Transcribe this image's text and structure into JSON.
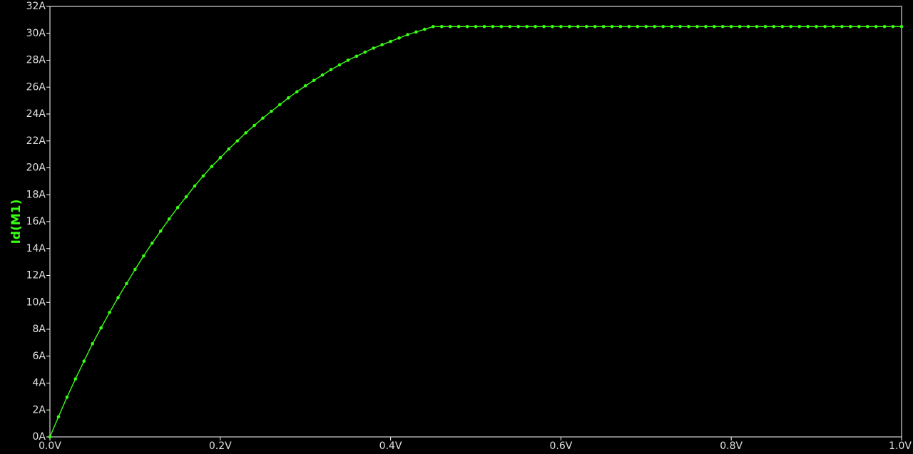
{
  "chart_data": {
    "type": "line",
    "xlabel": "",
    "ylabel": "Id(M1)",
    "xlim": [
      0,
      1.0
    ],
    "ylim": [
      0,
      32
    ],
    "x_ticks": [
      "0.0V",
      "0.2V",
      "0.4V",
      "0.6V",
      "0.8V",
      "1.0V"
    ],
    "x_tick_values": [
      0,
      0.2,
      0.4,
      0.6,
      0.8,
      1.0
    ],
    "y_ticks": [
      "0A",
      "2A",
      "4A",
      "6A",
      "8A",
      "10A",
      "12A",
      "14A",
      "16A",
      "18A",
      "20A",
      "22A",
      "24A",
      "26A",
      "28A",
      "30A",
      "32A"
    ],
    "y_tick_values": [
      0,
      2,
      4,
      6,
      8,
      10,
      12,
      14,
      16,
      18,
      20,
      22,
      24,
      26,
      28,
      30,
      32
    ],
    "grid": false,
    "background": "#000000",
    "axis_color": "#ffffff",
    "series": [
      {
        "color": "#39ff14",
        "markers": true,
        "x": [
          0,
          0.01,
          0.02,
          0.03,
          0.04,
          0.05,
          0.06,
          0.07,
          0.08,
          0.09,
          0.1,
          0.11,
          0.12,
          0.13,
          0.14,
          0.15,
          0.16,
          0.17,
          0.18,
          0.19,
          0.2,
          0.21,
          0.22,
          0.23,
          0.24,
          0.25,
          0.26,
          0.27,
          0.28,
          0.29,
          0.3,
          0.31,
          0.32,
          0.33,
          0.34,
          0.35,
          0.36,
          0.37,
          0.38,
          0.39,
          0.4,
          0.41,
          0.42,
          0.43,
          0.44,
          0.45,
          0.46,
          0.47,
          0.48,
          0.49,
          0.5,
          0.51,
          0.52,
          0.53,
          0.54,
          0.55,
          0.56,
          0.57,
          0.58,
          0.59,
          0.6,
          0.61,
          0.62,
          0.63,
          0.64,
          0.65,
          0.66,
          0.67,
          0.68,
          0.69,
          0.7,
          0.71,
          0.72,
          0.73,
          0.74,
          0.75,
          0.76,
          0.77,
          0.78,
          0.79,
          0.8,
          0.81,
          0.82,
          0.83,
          0.84,
          0.85,
          0.86,
          0.87,
          0.88,
          0.89,
          0.9,
          0.91,
          0.92,
          0.93,
          0.94,
          0.95,
          0.96,
          0.97,
          0.98,
          0.99,
          1.0
        ],
        "y": [
          0,
          1.49,
          2.95,
          4.31,
          5.63,
          6.93,
          8.1,
          9.25,
          10.35,
          11.4,
          12.45,
          13.45,
          14.4,
          15.3,
          16.2,
          17.05,
          17.85,
          18.65,
          19.4,
          20.1,
          20.75,
          21.4,
          22.0,
          22.6,
          23.15,
          23.7,
          24.2,
          24.7,
          25.2,
          25.65,
          26.1,
          26.5,
          26.9,
          27.3,
          27.65,
          28.0,
          28.3,
          28.6,
          28.9,
          29.15,
          29.4,
          29.65,
          29.9,
          30.1,
          30.3,
          30.5,
          30.5,
          30.5,
          30.5,
          30.5,
          30.5,
          30.5,
          30.5,
          30.5,
          30.5,
          30.5,
          30.5,
          30.5,
          30.5,
          30.5,
          30.5,
          30.5,
          30.5,
          30.5,
          30.5,
          30.5,
          30.5,
          30.5,
          30.5,
          30.5,
          30.5,
          30.5,
          30.5,
          30.5,
          30.5,
          30.5,
          30.5,
          30.5,
          30.5,
          30.5,
          30.5,
          30.5,
          30.5,
          30.5,
          30.5,
          30.5,
          30.5,
          30.5,
          30.5,
          30.5,
          30.5,
          30.5,
          30.5,
          30.5,
          30.5,
          30.5,
          30.5,
          30.5,
          30.5,
          30.5,
          30.5
        ]
      }
    ]
  }
}
